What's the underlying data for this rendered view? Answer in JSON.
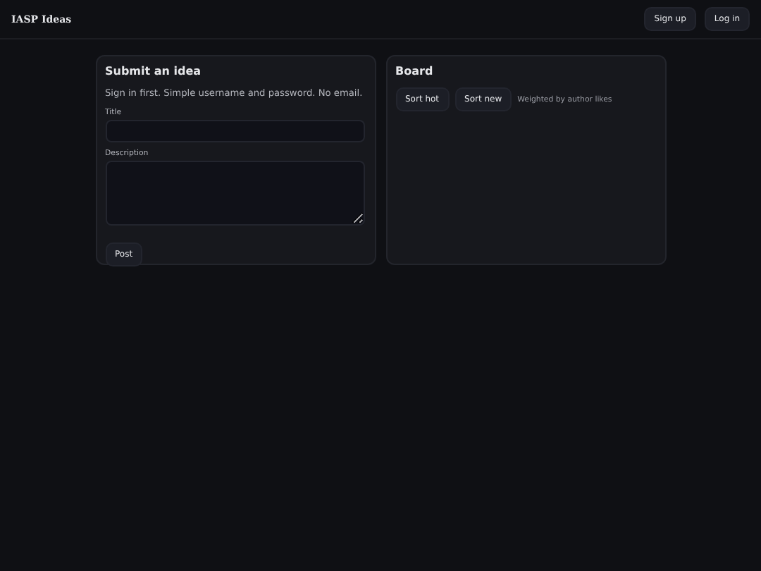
{
  "header": {
    "title": "IASP Ideas",
    "buttons": [
      "Sign up",
      "Log in"
    ]
  },
  "submit": {
    "heading": "Submit an idea",
    "note": "Sign in first. Simple username and password. No email.",
    "title_label": "Title",
    "description_label": "Description",
    "post_button": "Post"
  },
  "board": {
    "heading": "Board",
    "sort_buttons": [
      "Sort hot",
      "Sort new"
    ],
    "hint": "Weighted by author likes"
  }
}
